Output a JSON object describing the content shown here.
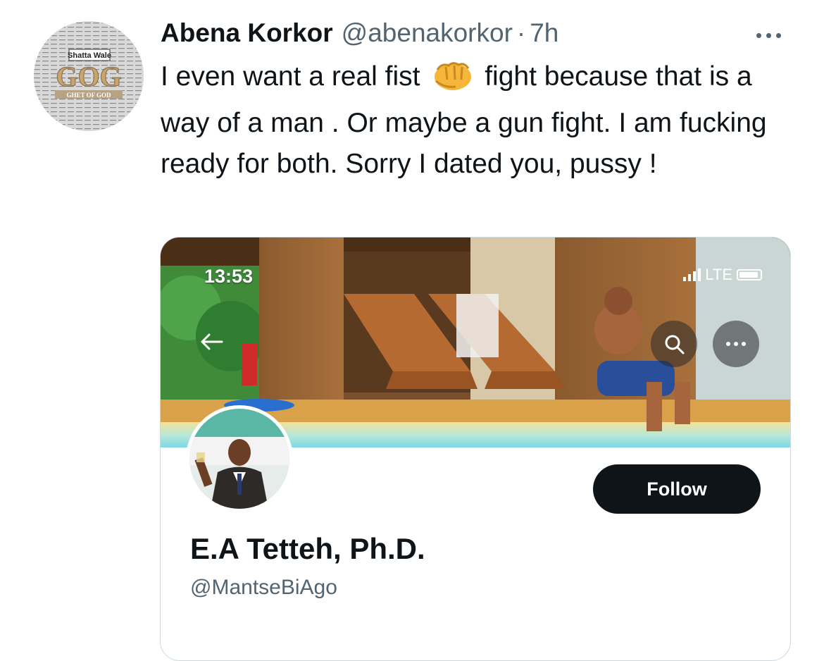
{
  "tweet": {
    "author_name": "Abena Korkor",
    "author_handle": "@abenakorkor",
    "separator": "·",
    "timestamp": "7h",
    "text_part1": "I even want a real fist",
    "emoji": "fist-emoji",
    "text_part2": "fight because that is a way of a man . Or maybe a gun fight. I am fucking ready for both. Sorry I dated you, pussy !"
  },
  "avatar_logo": {
    "label_top": "Shatta Wale",
    "label_big": "GOG",
    "label_bottom": "GHET OF GOD"
  },
  "embedded_card": {
    "status_time": "13:53",
    "status_network": "LTE",
    "follow_label": "Follow",
    "profile_name": "E.A Tetteh, Ph.D.",
    "profile_handle": "@MantseBiAgo"
  },
  "colors": {
    "text_primary": "#0f1419",
    "text_secondary": "#536471",
    "follow_bg": "#0f1419",
    "border": "#cfd9de"
  }
}
